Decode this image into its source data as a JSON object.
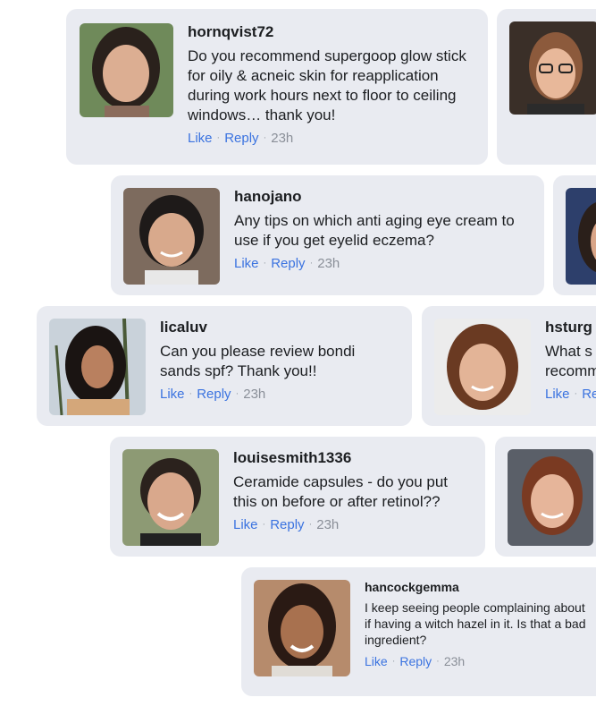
{
  "actions": {
    "like": "Like",
    "reply": "Reply"
  },
  "comments": [
    {
      "username": "hornqvist72",
      "text": "Do you recommend supergoop glow stick for oily & acneic skin for reapplication during work hours next to floor to ceiling windows… thank you!",
      "time": "23h"
    },
    {
      "username": "hanojano",
      "text": "Any tips on which anti aging eye cream to use if you get eyelid eczema?",
      "time": "23h"
    },
    {
      "username": "licaluv",
      "text": "Can you please review bondi sands spf? Thank you!!",
      "time": "23h"
    },
    {
      "username": "hsturg",
      "text": "What s recomm",
      "time": ""
    },
    {
      "username": "louisesmith1336",
      "text": "Ceramide capsules - do you put this on before or after retinol??",
      "time": "23h"
    },
    {
      "username": "hancockgemma",
      "text": "I keep seeing people complaining about if having a witch hazel in it. Is that a bad ingredient?",
      "time": "23h"
    }
  ],
  "colors": {
    "card_bg": "#e9ebf1",
    "link": "#3b73e0",
    "meta": "#8a8f98",
    "text": "#1c1e21"
  }
}
